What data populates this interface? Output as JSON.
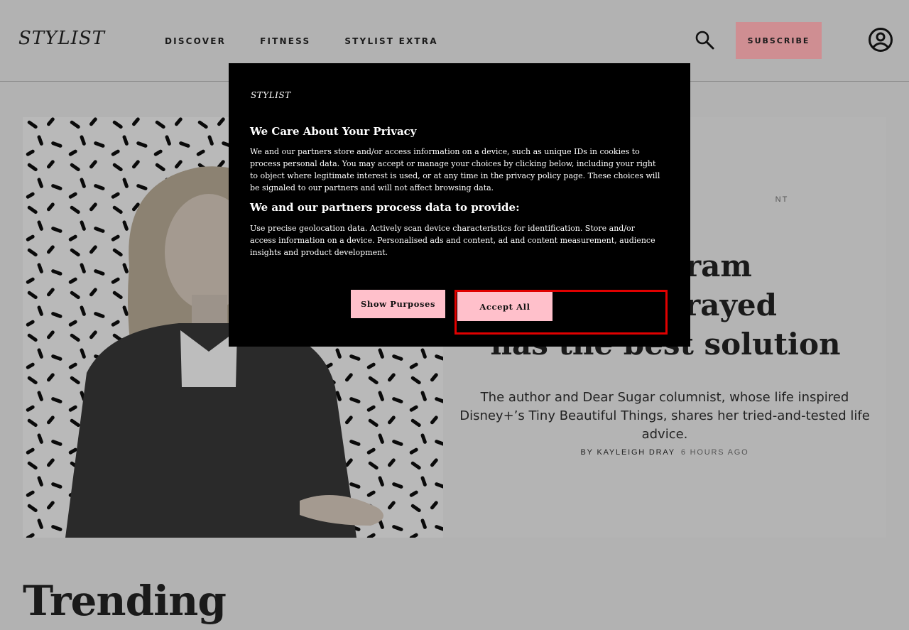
{
  "header": {
    "logo": "STYLIST",
    "nav": [
      "DISCOVER",
      "FITNESS",
      "STYLIST EXTRA"
    ],
    "subscribe_label": "SUBSCRIBE",
    "search_icon": "search-icon",
    "account_icon": "account-icon"
  },
  "hero": {
    "kicker": "NT",
    "headline_lines": [
      "Instagram",
      "heryl Strayed",
      "has the best solution"
    ],
    "standfirst": "The author and Dear Sugar columnist, whose life inspired Disney+’s Tiny Beautiful Things, shares her tried-and-tested life advice.",
    "byline_author": "BY KAYLEIGH DRAY",
    "byline_time": "6 HOURS AGO"
  },
  "trending": "Trending",
  "consent": {
    "logo": "STYLIST",
    "title": "We Care About Your Privacy",
    "body": "We and our partners store and/or access information on a device, such as unique IDs in cookies to process personal data. You may accept or manage your choices by clicking below, including your right to object where legitimate interest is used, or at any time in the privacy policy page. These choices will be signaled to our partners and will not affect browsing data.",
    "subtitle": "We and our partners process data to provide:",
    "body2": "Use precise geolocation data. Actively scan device characteristics for identification. Store and/or access information on a device. Personalised ads and content, ad and content measurement, audience insights and product development.",
    "show_purposes_label": "Show Purposes",
    "accept_all_label": "Accept All"
  }
}
